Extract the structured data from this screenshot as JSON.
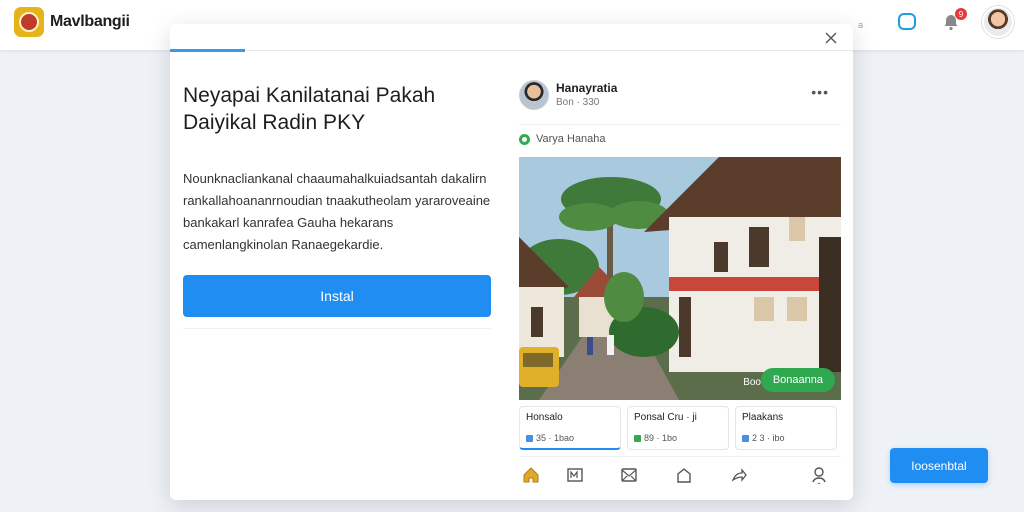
{
  "app": {
    "name": "Mavlbangii"
  },
  "topbar": {
    "notification_count": "9",
    "dim_text": "a"
  },
  "modal": {
    "title": "Neyapai Kanilatanai Pakah Daiyikal Radin PKY",
    "description": "Nounknacliankanal chaaumahalkuiadsantah dakalirn rankallahoananrnoudian tnaakutheolam yararoveaine bankakarl kanrafea Gauha hekarans camenlangkinolan Ranaegekardie.",
    "install_label": "Instal",
    "progress": 0.11
  },
  "post": {
    "author": "Hanayratia",
    "meta": "Bon · 330",
    "location": "Varya Hanaha",
    "image_caption": "Boo",
    "follow_label": "Bonaanna",
    "cards": [
      {
        "title": "Honsalo",
        "stat": "35 · 1bao",
        "color": "#4a90e2"
      },
      {
        "title": "Ponsal Cru · ji",
        "stat": "89 · 1bo",
        "color": "#36a852"
      },
      {
        "title": "Plaakans",
        "stat": "2 3 · ibo",
        "color": "#4a90e2"
      }
    ]
  },
  "float_button": {
    "label": "Ioosenbtal"
  },
  "colors": {
    "accent": "#1f8df2",
    "success": "#2fa84f",
    "brand": "#e7b31b"
  },
  "icons": [
    "home-icon",
    "news-icon",
    "mail-icon",
    "shop-icon",
    "share-icon",
    "profile-icon"
  ]
}
